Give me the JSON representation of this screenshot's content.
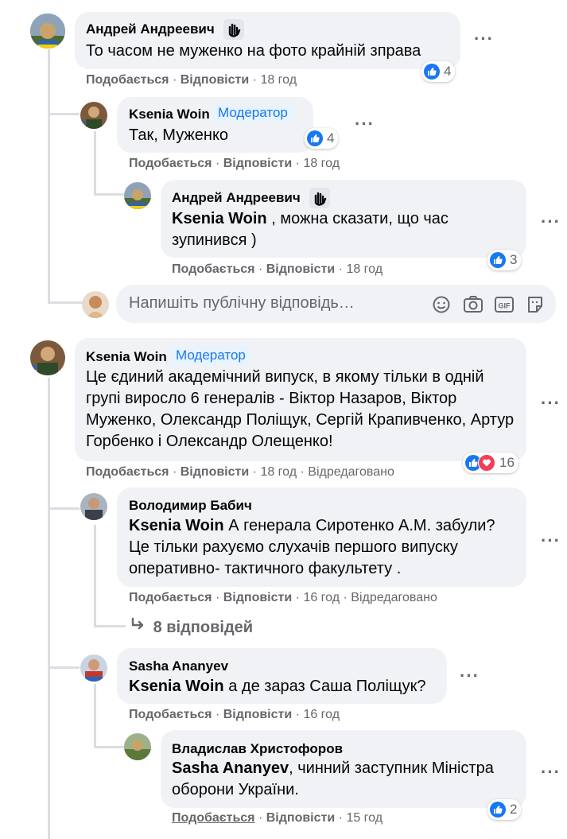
{
  "colors": {
    "accent": "#1877f2",
    "bubble": "#f0f2f5",
    "meta": "#65676b",
    "love": "#f33e58"
  },
  "actions": {
    "like": "Подобається",
    "reply": "Відповісти"
  },
  "comments": {
    "c1": {
      "author": "Андрей Андреевич",
      "text": "То часом не муженко на фото крайній зправа",
      "time": "18 год",
      "reactions": "4",
      "icon": "waving-hand-icon"
    },
    "c2": {
      "author": "Ksenia Woin",
      "badge": "Модератор",
      "text": "Так, Муженко",
      "time": "18 год",
      "reactions": "4"
    },
    "c3": {
      "author": "Андрей Андреевич",
      "mention": "Ksenia Woin",
      "text": " , можна сказати, що час зупинився )",
      "time": "18 год",
      "reactions": "3"
    },
    "reply_input": {
      "placeholder": "Напишіть публічну відповідь…"
    },
    "c4": {
      "author": "Ksenia Woin",
      "badge": "Модератор",
      "text": "Це єдиний академічний випуск, в якому тільки в одній групі виросло 6 генералів - Віктор Назаров, Віктор Муженко, Олександр Поліщук, Сергій Крапивченко, Артур Горбенко і Олександр Олещенко!",
      "time": "18 год",
      "edited": "Відредаговано",
      "reactions": "16"
    },
    "c5": {
      "author": "Володимир Бабич",
      "mention": "Ksenia Woin",
      "text": " А генерала Сиротенко А.М. забули? Це тільки рахуємо слухачів першого випуску оперативно- тактичного факультету .",
      "time": "16 год",
      "edited": "Відредаговано"
    },
    "more_replies": "8 відповідей",
    "c6": {
      "author": "Sasha Ananyev",
      "mention": "Ksenia Woin",
      "text": " а де зараз Саша Поліщук?",
      "time": "16 год"
    },
    "c7": {
      "author": "Владислав Христофоров",
      "mention": "Sasha Ananyev",
      "text": ", чинний заступник Міністра оборони України.",
      "time": "15 год",
      "reactions": "2"
    }
  },
  "separator": "·"
}
